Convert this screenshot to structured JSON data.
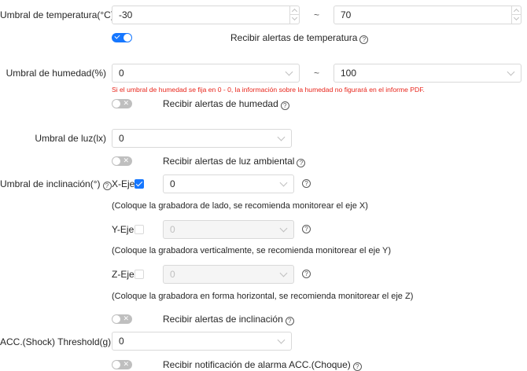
{
  "temperature": {
    "label": "Umbral de temperatura(°C)",
    "min": "-30",
    "separator": "~",
    "max": "70",
    "alert_label": "Recibir alertas de temperatura",
    "alert_enabled": true
  },
  "humidity": {
    "label": "Umbral de humedad(%)",
    "min": "0",
    "separator": "~",
    "max": "100",
    "warning": "Si el umbral de humedad se fija en 0 - 0, la información sobre la humedad no figurará en el informe PDF.",
    "alert_label": "Recibir alertas de humedad",
    "alert_enabled": false
  },
  "light": {
    "label": "Umbral de luz(lx)",
    "value": "0",
    "alert_label": "Recibir alertas de luz ambiental",
    "alert_enabled": false
  },
  "tilt": {
    "label": "Umbral de inclinación(°)",
    "x": {
      "label": "X-Eje",
      "checked": true,
      "value": "0",
      "hint": "(Coloque la grabadora de lado, se recomienda monitorear el eje X)"
    },
    "y": {
      "label": "Y-Eje",
      "checked": false,
      "value": "0",
      "hint": "(Coloque la grabadora verticalmente, se recomienda monitorear el eje Y)"
    },
    "z": {
      "label": "Z-Eje",
      "checked": false,
      "value": "0",
      "hint": "(Coloque la grabadora en forma horizontal, se recomienda monitorear el eje Z)"
    },
    "alert_label": "Recibir alertas de inclinación",
    "alert_enabled": false
  },
  "shock": {
    "label": "ACC.(Shock) Threshold(g)",
    "value": "0",
    "alert_label": "Recibir notificación de alarma ACC.(Choque)",
    "alert_enabled": false
  },
  "icons": {
    "help": "?",
    "switch_off": "✕"
  },
  "colors": {
    "accent": "#1677ff",
    "warning": "#e8251b",
    "border": "#d9d9d9"
  }
}
